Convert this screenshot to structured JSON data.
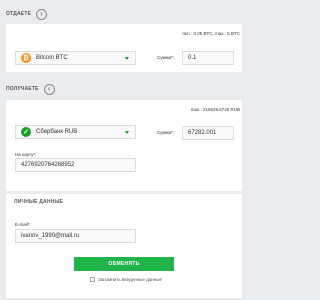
{
  "give": {
    "title": "ОТДАЕТЕ",
    "toggle_icon": "arrow-right-circle-icon",
    "limits": "min.: 0.05 BTC, max.: 5 BTC",
    "currency": "Bitcoin BTC",
    "currency_icon": "bitcoin-icon",
    "sum_label": "Сумма*:",
    "sum_value": "0.1"
  },
  "receive": {
    "title": "ПОЛУЧАЕТЕ",
    "toggle_icon": "arrow-left-circle-icon",
    "limits": "max.: 216529.6746 RUB",
    "currency": "Сбербанк RUB",
    "currency_icon": "sberbank-icon",
    "sum_label": "Сумма*:",
    "sum_value": "67282.001",
    "card_label": "На карту*:",
    "card_value": "4276920764268952"
  },
  "personal": {
    "title": "ЛИЧНЫЕ ДАННЫЕ",
    "email_label": "E-mail*:",
    "email_value": "ivanov_1990@mail.ru"
  },
  "actions": {
    "submit_label": "ОБМЕНЯТЬ",
    "remember_label": "Запомнить введенные данные"
  },
  "colors": {
    "accent_green": "#21b44b",
    "bitcoin_orange": "#f7931a",
    "background": "#e9ecef"
  }
}
